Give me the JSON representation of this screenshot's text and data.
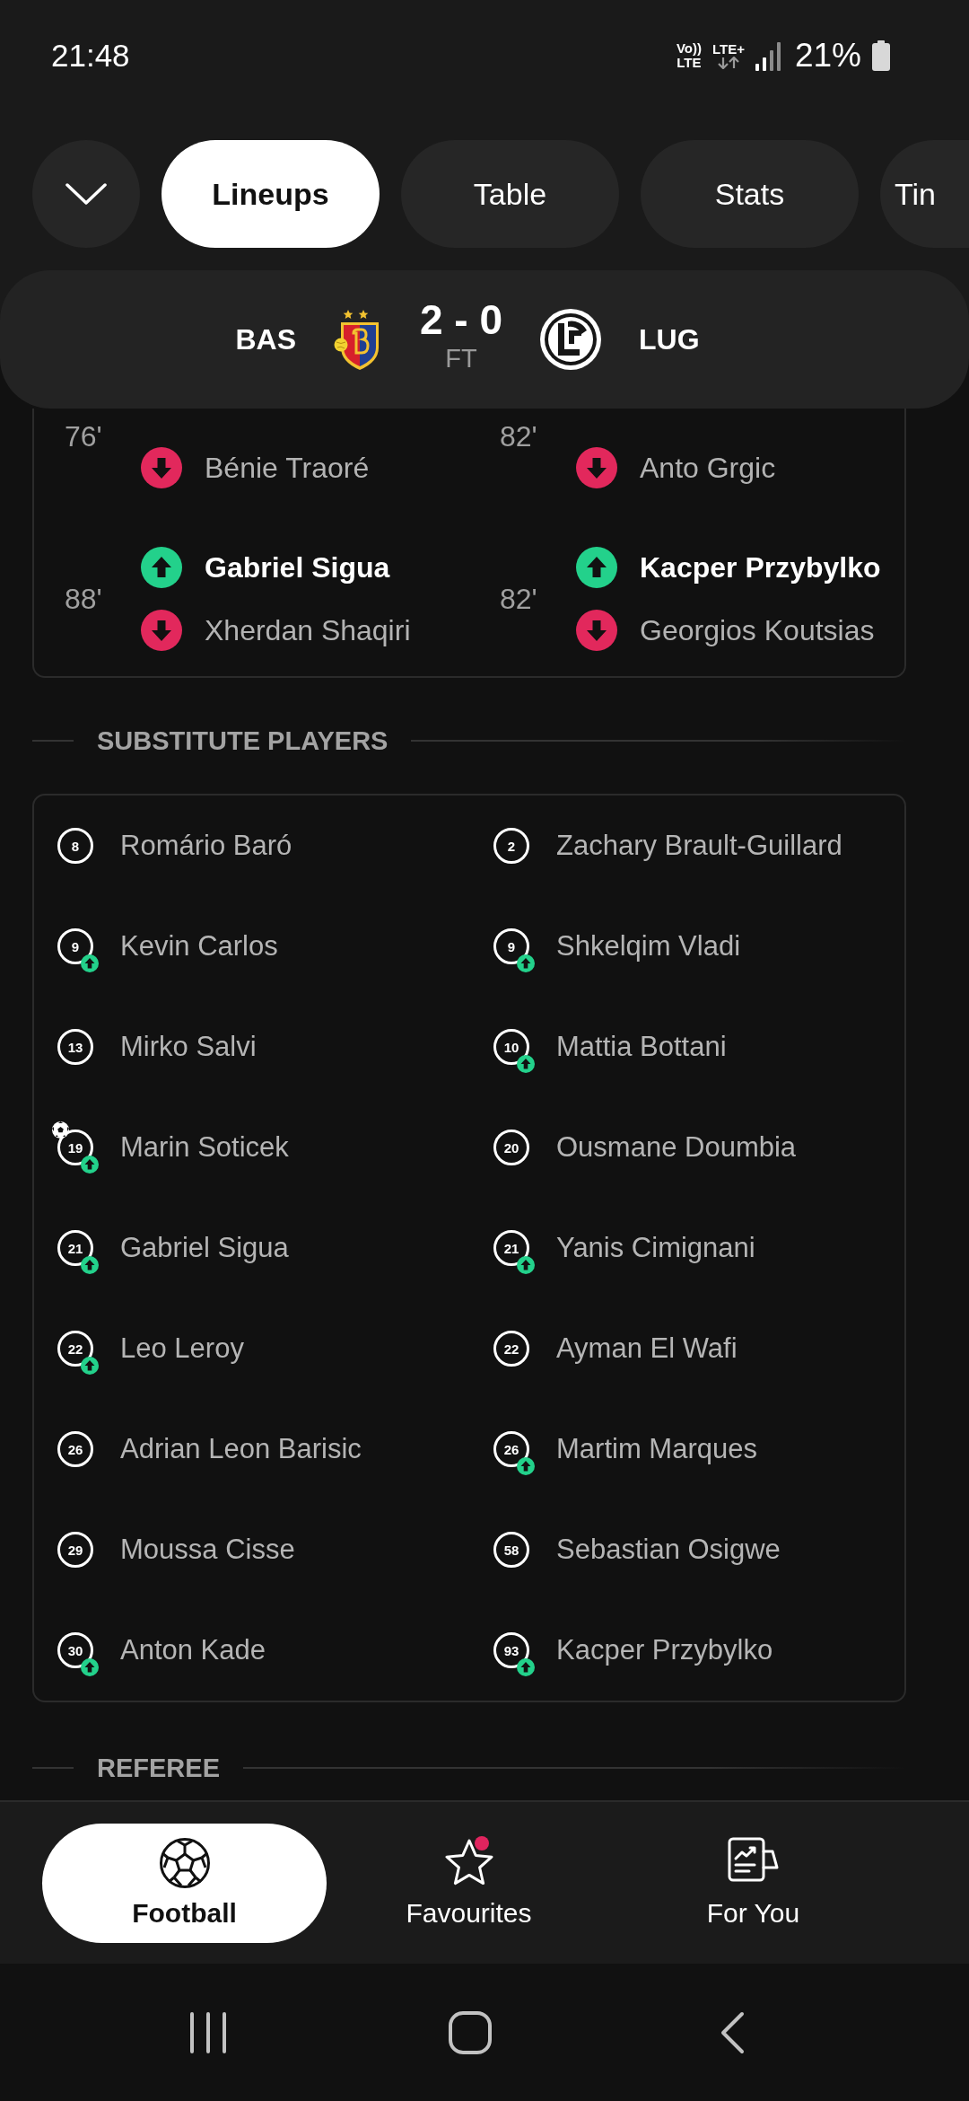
{
  "status_bar": {
    "time": "21:48",
    "volte": [
      "Vo))",
      "LTE"
    ],
    "network": "LTE+",
    "battery": "21%"
  },
  "tabs": [
    {
      "label": "Lineups",
      "selected": true
    },
    {
      "label": "Table",
      "selected": false
    },
    {
      "label": "Stats",
      "selected": false
    },
    {
      "label": "Tin",
      "selected": false
    }
  ],
  "match_header": {
    "home_team": "BAS",
    "score": "2 - 0",
    "status": "FT",
    "away_team": "LUG"
  },
  "substitutions": {
    "home": [
      {
        "minute": "76'",
        "player_out": "Bénie Traoré"
      },
      {
        "minute": "88'",
        "player_in": "Gabriel Sigua",
        "player_out": "Xherdan Shaqiri"
      }
    ],
    "away": [
      {
        "minute": "82'",
        "player_out": "Anto Grgic"
      },
      {
        "minute": "82'",
        "player_in": "Kacper Przybylko",
        "player_out": "Georgios Koutsias"
      }
    ]
  },
  "substitute_players": {
    "title": "SUBSTITUTE PLAYERS",
    "home": [
      {
        "number": "8",
        "name": "Romário Baró",
        "subbed_in": false,
        "goal": false
      },
      {
        "number": "9",
        "name": "Kevin Carlos",
        "subbed_in": true,
        "goal": false
      },
      {
        "number": "13",
        "name": "Mirko Salvi",
        "subbed_in": false,
        "goal": false
      },
      {
        "number": "19",
        "name": "Marin Soticek",
        "subbed_in": true,
        "goal": true
      },
      {
        "number": "21",
        "name": "Gabriel Sigua",
        "subbed_in": true,
        "goal": false
      },
      {
        "number": "22",
        "name": "Leo Leroy",
        "subbed_in": true,
        "goal": false
      },
      {
        "number": "26",
        "name": "Adrian Leon Barisic",
        "subbed_in": false,
        "goal": false
      },
      {
        "number": "29",
        "name": "Moussa Cisse",
        "subbed_in": false,
        "goal": false
      },
      {
        "number": "30",
        "name": "Anton Kade",
        "subbed_in": true,
        "goal": false
      }
    ],
    "away": [
      {
        "number": "2",
        "name": "Zachary Brault-Guillard",
        "subbed_in": false,
        "goal": false
      },
      {
        "number": "9",
        "name": "Shkelqim Vladi",
        "subbed_in": true,
        "goal": false
      },
      {
        "number": "10",
        "name": "Mattia Bottani",
        "subbed_in": true,
        "goal": false
      },
      {
        "number": "20",
        "name": "Ousmane Doumbia",
        "subbed_in": false,
        "goal": false
      },
      {
        "number": "21",
        "name": "Yanis Cimignani",
        "subbed_in": true,
        "goal": false
      },
      {
        "number": "22",
        "name": "Ayman El Wafi",
        "subbed_in": false,
        "goal": false
      },
      {
        "number": "26",
        "name": "Martim Marques",
        "subbed_in": true,
        "goal": false
      },
      {
        "number": "58",
        "name": "Sebastian Osigwe",
        "subbed_in": false,
        "goal": false
      },
      {
        "number": "93",
        "name": "Kacper Przybylko",
        "subbed_in": true,
        "goal": false
      }
    ]
  },
  "referee": {
    "title": "REFEREE"
  },
  "bottom_nav": [
    {
      "kind": "football",
      "label": "Football",
      "selected": true,
      "badge": false
    },
    {
      "kind": "favourites",
      "label": "Favourites",
      "selected": false,
      "badge": true
    },
    {
      "kind": "for_you",
      "label": "For You",
      "selected": false,
      "badge": false
    }
  ]
}
